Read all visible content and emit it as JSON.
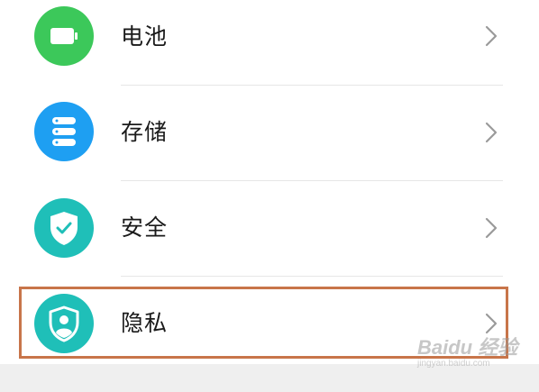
{
  "settings_items": [
    {
      "label": "电池",
      "icon": "battery-icon",
      "color": "#3cc85a"
    },
    {
      "label": "存储",
      "icon": "storage-icon",
      "color": "#1e9ff2"
    },
    {
      "label": "安全",
      "icon": "shield-check-icon",
      "color": "#1fbfb8"
    },
    {
      "label": "隐私",
      "icon": "privacy-icon",
      "color": "#1fbfb8"
    }
  ],
  "highlight_color": "#c8754a",
  "watermark": {
    "logo": "Baidu 经验",
    "url": "jingyan.baidu.com"
  }
}
